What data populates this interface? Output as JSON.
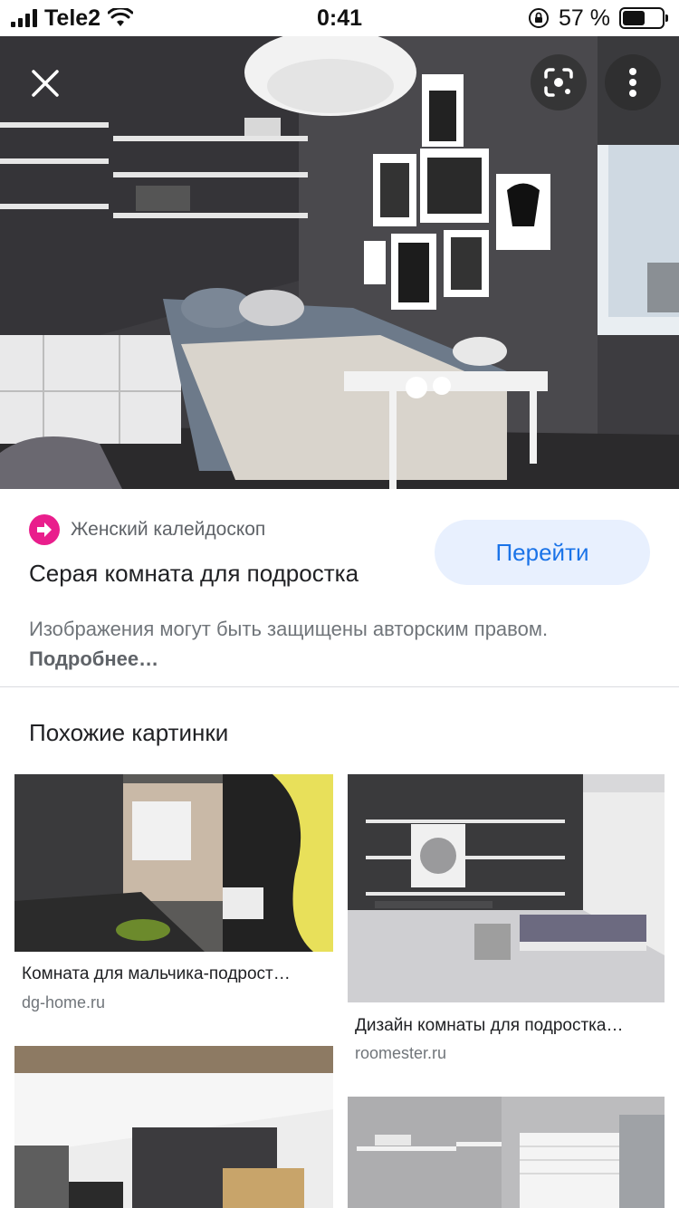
{
  "status_bar": {
    "carrier": "Tele2",
    "time": "0:41",
    "battery_percent": "57 %",
    "battery_level": 0.57
  },
  "viewer": {
    "icons": [
      "close-icon",
      "lens-icon",
      "more-vert-icon"
    ]
  },
  "result": {
    "source": "Женский калейдоскоп",
    "title": "Серая комната для подростка",
    "go_label": "Перейти",
    "copyright_text": "Изображения могут быть защищены авторским правом.",
    "more_link": "Подробнее…"
  },
  "similar": {
    "heading": "Похожие картинки",
    "items": [
      {
        "caption": "Комната для мальчика-подрост…",
        "domain": "dg-home.ru"
      },
      {
        "caption": "Дизайн комнаты для подростка…",
        "domain": "roomester.ru"
      },
      {
        "caption": "",
        "domain": ""
      },
      {
        "caption": "",
        "domain": ""
      }
    ]
  },
  "colors": {
    "accent": "#1a73e8",
    "button_bg": "#e8f0fe",
    "favicon": "#e91e8c"
  }
}
